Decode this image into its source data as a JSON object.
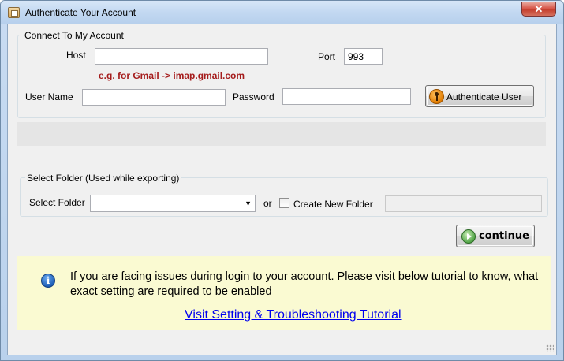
{
  "window": {
    "title": "Authenticate Your Account",
    "close_label": "✕"
  },
  "connect": {
    "legend": "Connect To My Account",
    "host_label": "Host",
    "host_value": "",
    "port_label": "Port",
    "port_value": "993",
    "hint": "e.g. for Gmail -> imap.gmail.com",
    "username_label": "User Name",
    "username_value": "",
    "password_label": "Password",
    "password_value": "",
    "auth_button": "Authenticate User"
  },
  "folder": {
    "legend": "Select Folder (Used while exporting)",
    "select_label": "Select Folder",
    "select_value": "",
    "or_label": "or",
    "create_label": "Create New Folder",
    "create_checked": false,
    "new_folder_value": ""
  },
  "actions": {
    "continue_label": "continue"
  },
  "info": {
    "text": "If you are facing issues during login to your account. Please visit below tutorial to know, what exact setting are required to be enabled",
    "link": "Visit Setting & Troubleshooting Tutorial"
  },
  "icons": {
    "app": "app-icon",
    "auth": "key-icon",
    "continue": "play-icon",
    "info": "info-icon",
    "dropdown": "chevron-down-icon"
  }
}
